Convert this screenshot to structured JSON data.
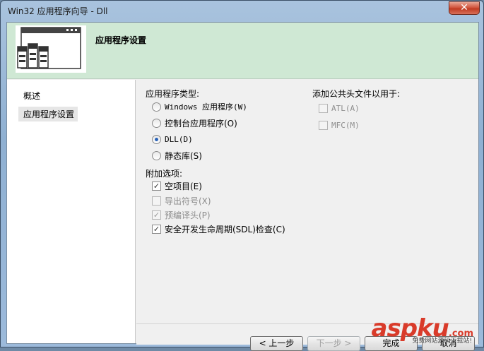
{
  "window": {
    "title": "Win32 应用程序向导 - Dll",
    "close_glyph": "✕"
  },
  "header": {
    "title": "应用程序设置"
  },
  "nav": {
    "items": [
      {
        "label": "概述"
      },
      {
        "label": "应用程序设置"
      }
    ]
  },
  "app_type": {
    "label": "应用程序类型:",
    "options": [
      {
        "label": "Windows 应用程序(W)",
        "checked": false
      },
      {
        "label": "控制台应用程序(O)",
        "checked": false
      },
      {
        "label": "DLL(D)",
        "checked": true
      },
      {
        "label": "静态库(S)",
        "checked": false
      }
    ]
  },
  "extra": {
    "label": "附加选项:",
    "options": [
      {
        "label": "空项目(E)",
        "checked": true,
        "enabled": true
      },
      {
        "label": "导出符号(X)",
        "checked": false,
        "enabled": false
      },
      {
        "label": "预编译头(P)",
        "checked": true,
        "enabled": false
      },
      {
        "label": "安全开发生命周期(SDL)检查(C)",
        "checked": true,
        "enabled": true
      }
    ]
  },
  "common_headers": {
    "label": "添加公共头文件以用于:",
    "options": [
      {
        "label": "ATL(A)",
        "checked": false,
        "enabled": false
      },
      {
        "label": "MFC(M)",
        "checked": false,
        "enabled": false
      }
    ]
  },
  "buttons": {
    "prev": "< 上一步",
    "next": "下一步 >",
    "finish": "完成",
    "cancel": "取消"
  },
  "watermark": {
    "brand": "aspku",
    "domain_suffix": ".com",
    "subtitle": "免费网站源码下载站!"
  }
}
